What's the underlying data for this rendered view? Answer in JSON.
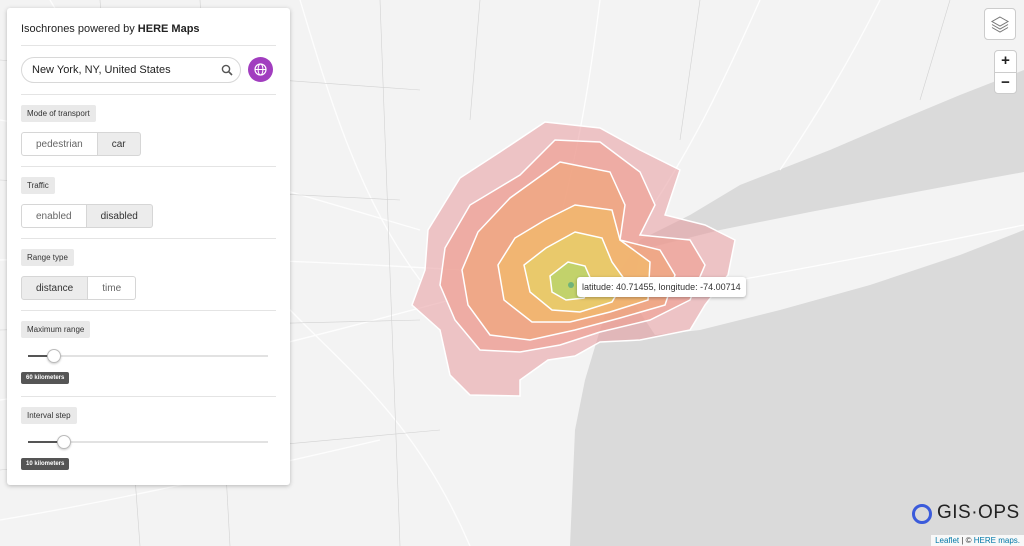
{
  "panel": {
    "title_prefix": "Isochrones powered by ",
    "title_brand": "HERE Maps",
    "search": {
      "value": "New York, NY, United States"
    },
    "sections": {
      "transport": {
        "label": "Mode of transport",
        "options": [
          "pedestrian",
          "car"
        ],
        "selected": "car"
      },
      "traffic": {
        "label": "Traffic",
        "options": [
          "enabled",
          "disabled"
        ],
        "selected": "disabled"
      },
      "range_type": {
        "label": "Range type",
        "options": [
          "distance",
          "time"
        ],
        "selected": "distance"
      },
      "max_range": {
        "label": "Maximum range",
        "value_label": "60 kilometers",
        "fraction": 0.11
      },
      "interval": {
        "label": "Interval step",
        "value_label": "10 kilometers",
        "fraction": 0.15
      }
    }
  },
  "map": {
    "tooltip": "latitude: 40.71455, longitude: -74.00714",
    "zoom_in": "+",
    "zoom_out": "−",
    "logo": "GIS·OPS",
    "attribution": {
      "leaflet": "Leaflet",
      "separator": " | © ",
      "here": "HERE maps."
    },
    "isochrone_colors": [
      "#e89a9f",
      "#ee9c8e",
      "#f0a679",
      "#f2bb6a",
      "#e5d06a",
      "#b8d46c"
    ]
  }
}
